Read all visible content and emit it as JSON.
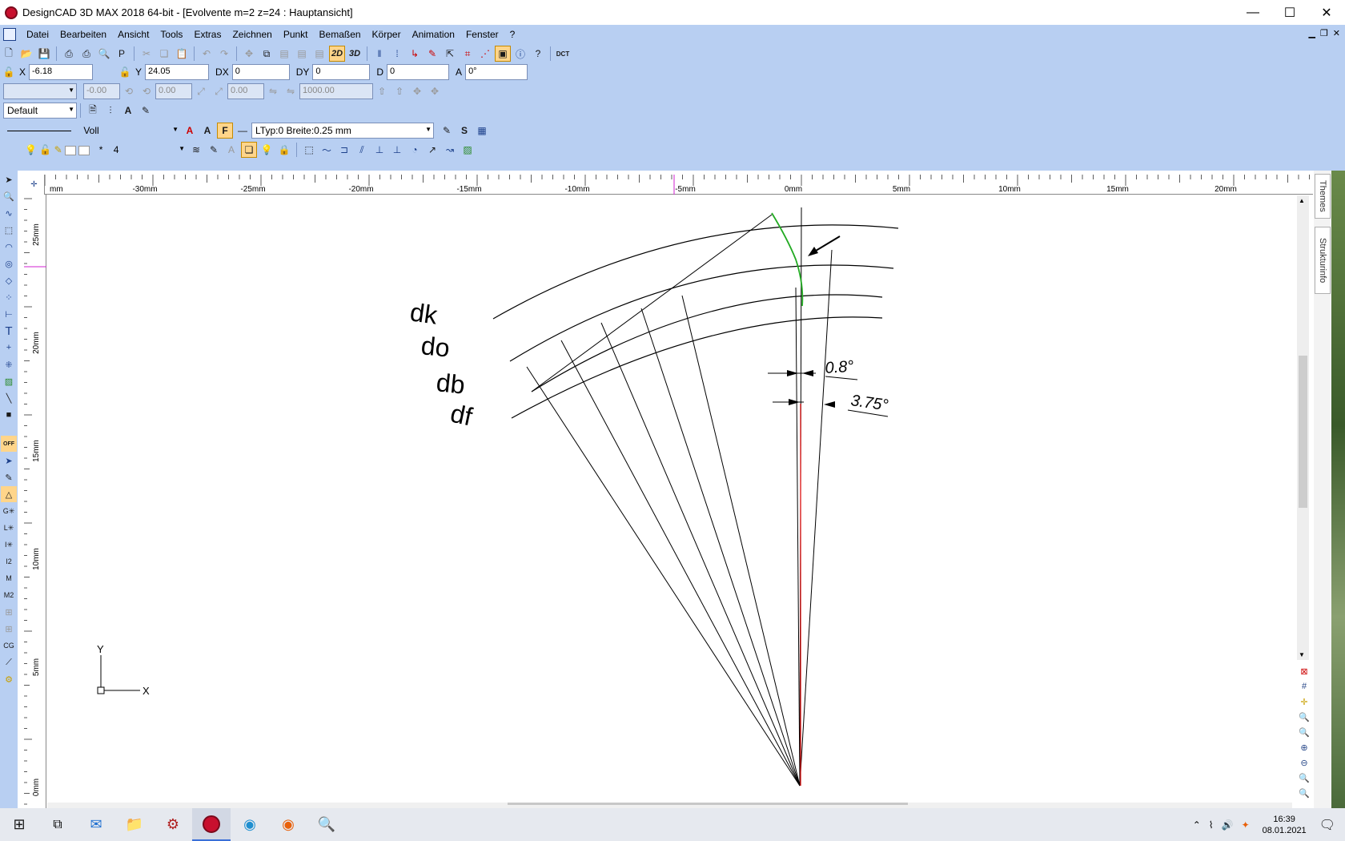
{
  "window": {
    "title": "DesignCAD 3D MAX 2018 64-bit - [Evolvente m=2  z=24 : Hauptansicht]",
    "controls": {
      "minimize": "—",
      "maximize": "☐",
      "close": "✕"
    }
  },
  "menu": {
    "items": [
      "Datei",
      "Bearbeiten",
      "Ansicht",
      "Tools",
      "Extras",
      "Zeichnen",
      "Punkt",
      "Bemaßen",
      "Körper",
      "Animation",
      "Fenster",
      "?"
    ]
  },
  "toolbar": {
    "view_2d": "2D",
    "view_3d": "3D",
    "dct": "DCT"
  },
  "coords": {
    "x_label": "X",
    "x_value": "-6.18",
    "y_label": "Y",
    "y_value": "24.05",
    "dx_label": "DX",
    "dx_value": "0",
    "dy_label": "DY",
    "dy_value": "0",
    "d_label": "D",
    "d_value": "0",
    "a_label": "A",
    "a_value": "0°"
  },
  "row3": {
    "field1": "-0.00",
    "field2": "0.00",
    "field3": "0.00",
    "field4": "1000.00"
  },
  "style_row": {
    "style_select": "Default"
  },
  "line_row": {
    "line_type": "Voll",
    "ltype_info": "LTyp:0  Breite:0.25 mm"
  },
  "layer_row": {
    "layer_prefix": "*",
    "layer_value": "4"
  },
  "ruler": {
    "h_labels": [
      "-30mm",
      "-25mm",
      "-20mm",
      "-15mm",
      "-10mm",
      "-5mm",
      "0mm",
      "5mm",
      "10mm",
      "15mm",
      "20mm"
    ],
    "h_first_label": "mm",
    "v_labels": [
      "25mm",
      "20mm",
      "15mm",
      "10mm",
      "5mm",
      "0mm"
    ]
  },
  "drawing": {
    "labels": {
      "dk": "dk",
      "do": "do",
      "db": "db",
      "df": "df"
    },
    "dims": {
      "angle1": "0.8°",
      "angle2": "3.75°"
    },
    "axes": {
      "x": "X",
      "y": "Y"
    },
    "colors": {
      "involute": "#22aa22",
      "centerline": "#dd1111",
      "lines": "#000000"
    }
  },
  "side_tabs": [
    "Themes",
    "Strukturinfo"
  ],
  "taskbar": {
    "time": "16:39",
    "date": "08.01.2021",
    "apps": [
      "start-icon",
      "task-view-icon",
      "mail-icon",
      "file-explorer-icon",
      "settings-app-icon",
      "designcad-icon",
      "edge-icon",
      "firefox-icon",
      "search-tool-icon"
    ]
  }
}
